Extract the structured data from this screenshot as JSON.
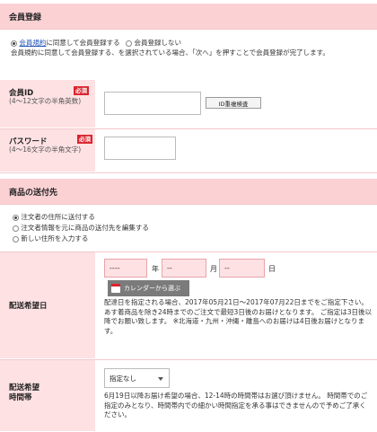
{
  "membership": {
    "header": "会員登録",
    "option_agree_prefix": "",
    "option_agree_link": "会員規約",
    "option_agree_suffix": "に同意して会員登録する",
    "option_decline": "会員登録しない",
    "note": "会員規約に同意して会員登録する、を選択されている場合、「次へ」を押すことで会員登録が完了します。"
  },
  "member_id": {
    "label": "会員ID",
    "hint": "(4〜12文字の半角英数)",
    "required": "必須",
    "check_button": "ID重複検査",
    "value": ""
  },
  "password": {
    "label": "パスワード",
    "hint": "(4〜16文字の半角文字)",
    "required": "必須",
    "value": ""
  },
  "shipping": {
    "header": "商品の送付先",
    "options": [
      "注文者の住所に送付する",
      "注文者情報を元に商品の送付先を編集する",
      "新しい住所を入力する"
    ],
    "selected_index": 0
  },
  "delivery_date": {
    "label": "配送希望日",
    "year": "----",
    "year_unit": "年",
    "month": "--",
    "month_unit": "月",
    "day": "--",
    "day_unit": "日",
    "calendar_button": "カレンダーから選ぶ",
    "note": "配達日を指定される場合、2017年05月21日〜2017年07月22日までをご指定下さい。 あす着商品を除き24時までのご注文で最短3日後のお届けとなります。 ご指定は3日後以降でお願い致します。 ※北海道・九州・沖縄・離島へのお届けは4日後お届けとなります。"
  },
  "delivery_time": {
    "label": "配送希望時間帯",
    "selected": "指定なし",
    "note": "6月19日以降お届け希望の場合、12-14時の時間帯はお選び頂けません。 時間帯でのご指定のみとなり、時間帯内での細かい時間指定を承る事はできませんので予めご了承ください。"
  },
  "colors": {
    "header_bg": "#fbd1d4",
    "label_bg": "#fde1e3",
    "required_badge": "#d9242e",
    "link": "#2154b8"
  }
}
